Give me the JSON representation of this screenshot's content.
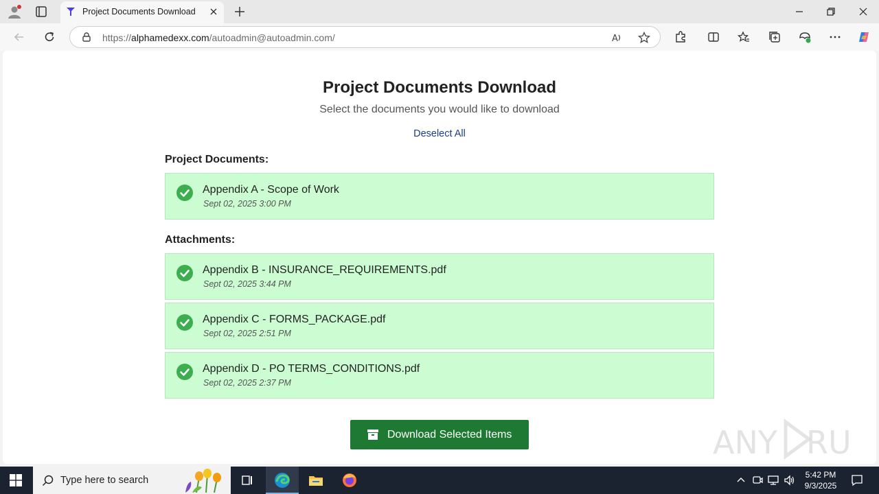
{
  "browser": {
    "tab_title": "Project Documents Download",
    "url_domain": "alphamedexx.com",
    "url_prefix": "https://",
    "url_path": "/autoadmin@autoadmin.com/"
  },
  "page": {
    "title": "Project Documents Download",
    "subtitle": "Select the documents you would like to download",
    "deselect_label": "Deselect All",
    "project_heading": "Project Documents:",
    "attachments_heading": "Attachments:",
    "project_documents": [
      {
        "name": "Appendix A - Scope of Work",
        "date": "Sept 02, 2025 3:00 PM"
      }
    ],
    "attachments": [
      {
        "name": "Appendix B - INSURANCE_REQUIREMENTS.pdf",
        "date": "Sept 02, 2025 3:44 PM"
      },
      {
        "name": "Appendix C - FORMS_PACKAGE.pdf",
        "date": "Sept 02, 2025 2:51 PM"
      },
      {
        "name": "Appendix D - PO TERMS_CONDITIONS.pdf",
        "date": "Sept 02, 2025 2:37 PM"
      }
    ],
    "download_label": "Download Selected Items",
    "watermark": "ANY RUN"
  },
  "taskbar": {
    "search_placeholder": "Type here to search",
    "time": "5:42 PM",
    "date": "9/3/2025"
  },
  "colors": {
    "item_bg": "#ccfdd2",
    "check_green": "#3dae4f",
    "button_green": "#1e7a32",
    "link_blue": "#1a3c8c"
  }
}
